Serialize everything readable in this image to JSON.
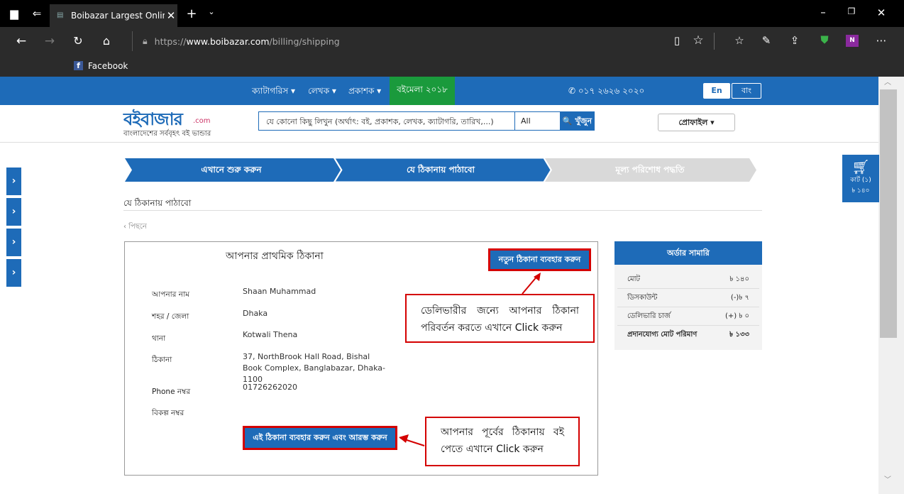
{
  "browser": {
    "tab_title": "Boibazar Largest Online",
    "url_prefix": "https://",
    "url_domain": "www.boibazar.com",
    "url_path": "/billing/shipping",
    "favorites": [
      {
        "label": "Facebook"
      }
    ]
  },
  "nav": {
    "categories": "ক্যাটাগরিস ▾",
    "writer": "লেখক ▾",
    "publisher": "প্রকাশক ▾",
    "boimela": "বইমেলা ২০১৮",
    "phone": "✆ ০১৭ ২৬২৬ ২০২০",
    "lang_en": "En",
    "lang_bn": "বাং"
  },
  "header": {
    "logo_text": "বইবাজার",
    "logo_suffix": ".com",
    "tagline": "বাংলাদেশের সর্ববৃহৎ বই ভান্ডার",
    "search_placeholder": "যে কোনো কিছু লিখুন (অর্থাৎ: বই, প্রকাশক, লেখক, ক্যাটাগরি, তারিখ,...)",
    "search_category": "All",
    "search_button": "🔍 খুঁজুন",
    "profile_button": "প্রোফাইল ▾"
  },
  "cart": {
    "label": "কার্ট (১)",
    "amount": "৳ ১৪০"
  },
  "steps": [
    {
      "label": "এখানে শুরু করুন",
      "state": "done"
    },
    {
      "label": "যে ঠিকানায় পাঠাবো",
      "state": "active"
    },
    {
      "label": "মূল্য পরিশোধ পদ্ধতি",
      "state": "pending"
    }
  ],
  "page": {
    "section_title": "যে ঠিকানায় পাঠাবো",
    "back_link": "‹ পিছনে"
  },
  "address": {
    "heading": "আপনার প্রাথমিক ঠিকানা",
    "new_address_button": "নতুন ঠিকানা ব্যবহার করুন",
    "fields": [
      {
        "label": "আপনার নাম",
        "value": "Shaan Muhammad"
      },
      {
        "label": "শহর / জেলা",
        "value": "Dhaka"
      },
      {
        "label": "থানা",
        "value": "Kotwali Thena"
      },
      {
        "label": "ঠিকানা",
        "value": "37, NorthBrook Hall Road, Bishal Book Complex, Banglabazar, Dhaka-1100"
      },
      {
        "label": "Phone নম্বর",
        "value": "01726262020"
      },
      {
        "label": "বিকল্প নম্বর",
        "value": ""
      }
    ],
    "use_address_button": "এই ঠিকানা ব্যবহার করুন এবং আরম্ভ করুন"
  },
  "callouts": {
    "new_address_hint": "ডেলিভারীর জন্যে আপনার ঠিকানা পরিবর্তন করতে এখানে Click করুন",
    "use_address_hint": "আপনার পূর্বের ঠিকানায় বই পেতে এখানে Click করুন"
  },
  "summary": {
    "title": "অর্ডার সামারি",
    "rows": [
      {
        "label": "মোট",
        "value": "৳ ১৪০"
      },
      {
        "label": "ডিসকাউন্ট",
        "value": "(-)৳ ৭"
      },
      {
        "label": "ডেলিভারি চার্জ",
        "value": "(+) ৳ ০"
      },
      {
        "label": "প্রদানযোগ্য মোট পরিমাণ",
        "value": "৳ ১৩৩"
      }
    ]
  },
  "colors": {
    "brand_blue": "#1e6bb8",
    "boimela_green": "#1a9a3c",
    "callout_red": "#d40000"
  }
}
